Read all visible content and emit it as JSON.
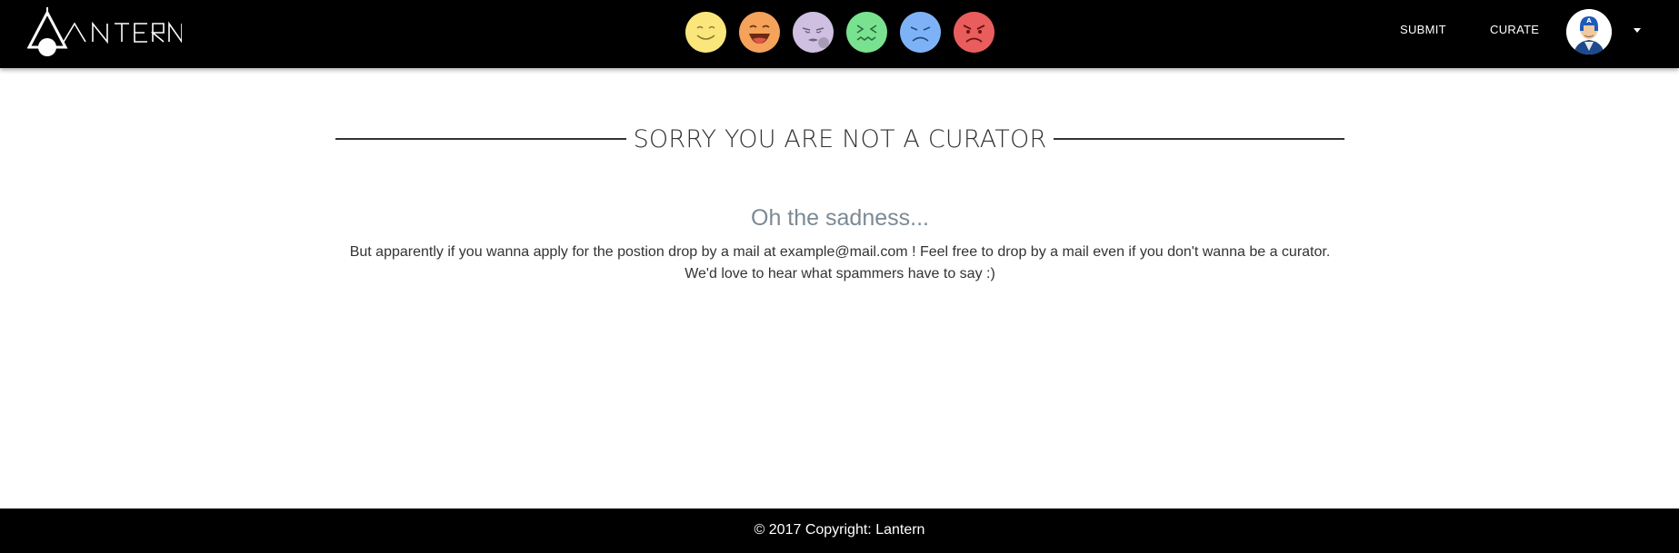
{
  "nav": {
    "logo_text": "Lantern",
    "moods": [
      {
        "icon": "happy-face-icon",
        "color": "#fbe67c"
      },
      {
        "icon": "laughing-face-icon",
        "color": "#f5a25a"
      },
      {
        "icon": "sleepy-face-icon",
        "color": "#cfc0e2"
      },
      {
        "icon": "nauseated-face-icon",
        "color": "#79e290"
      },
      {
        "icon": "sad-face-icon",
        "color": "#7db3f6"
      },
      {
        "icon": "angry-face-icon",
        "color": "#ea5d5d"
      }
    ],
    "submit_label": "SUBMIT",
    "curate_label": "CURATE",
    "avatar_icon": "user-avatar-icon",
    "menu_icon": "caret-down-icon"
  },
  "main": {
    "title": "SORRY YOU ARE NOT A CURATOR",
    "subtitle": "Oh the sadness...",
    "message": "But apparently if you wanna apply for the postion drop by a mail at example@mail.com ! Feel free to drop by a mail even if you don't wanna be a curator. We'd love to hear what spammers have to say :)"
  },
  "footer": {
    "copyright": "© 2017 Copyright: Lantern"
  },
  "colors": {
    "navbar_bg": "#000000",
    "footer_bg": "#000000",
    "subtitle": "#7b8a95"
  }
}
